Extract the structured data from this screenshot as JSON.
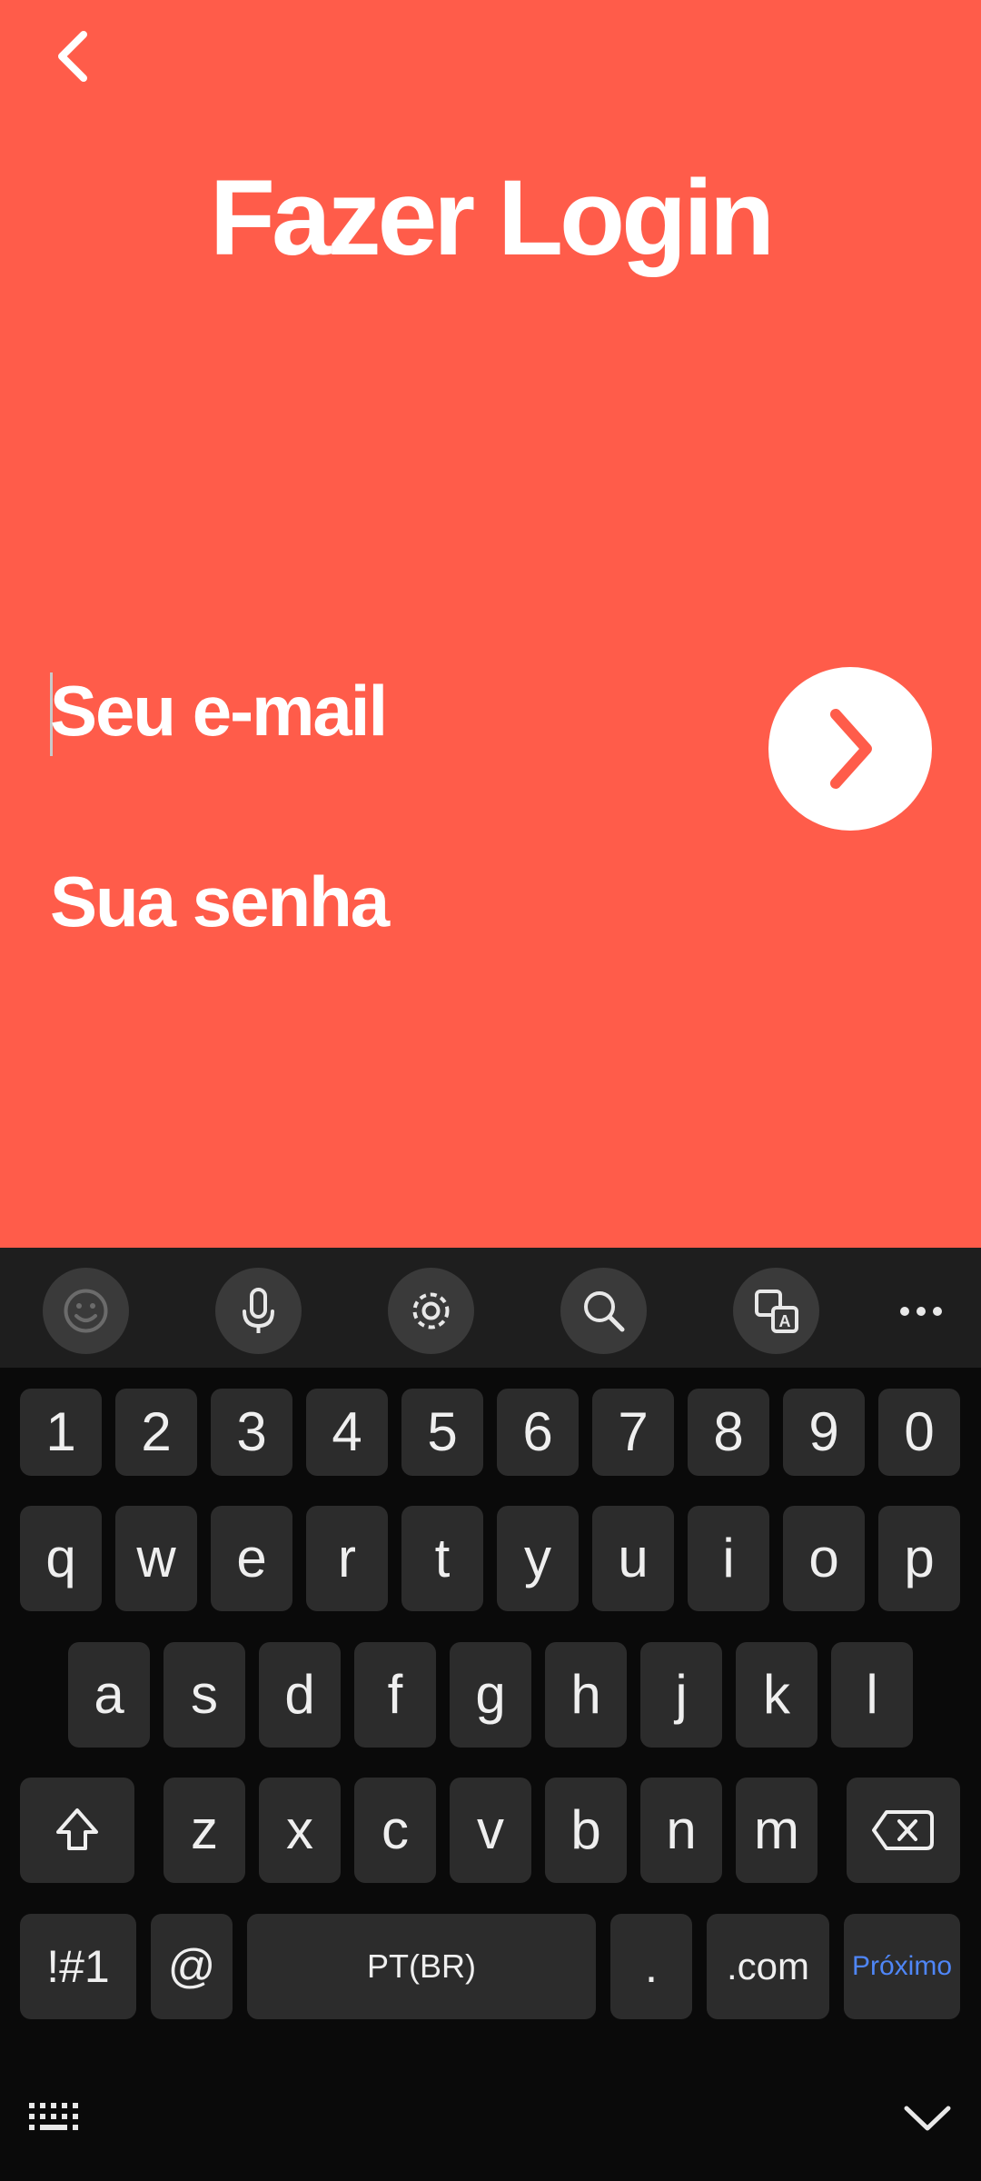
{
  "app": {
    "title": "Fazer Login",
    "email_placeholder": "Seu e-mail",
    "password_placeholder": "Sua senha",
    "colors": {
      "background": "#ff5c4a",
      "text": "#ffffff",
      "keyboard_bg": "#0a0a0a",
      "key_bg": "#2c2c2c",
      "action_blue": "#4f86f7"
    }
  },
  "keyboard": {
    "toolbar_icons": [
      "emoji-icon",
      "microphone-icon",
      "settings-icon",
      "search-icon",
      "translate-icon",
      "more-icon"
    ],
    "row_numbers": [
      "1",
      "2",
      "3",
      "4",
      "5",
      "6",
      "7",
      "8",
      "9",
      "0"
    ],
    "row_q": [
      "q",
      "w",
      "e",
      "r",
      "t",
      "y",
      "u",
      "i",
      "o",
      "p"
    ],
    "row_a": [
      "a",
      "s",
      "d",
      "f",
      "g",
      "h",
      "j",
      "k",
      "l"
    ],
    "row_z": [
      "z",
      "x",
      "c",
      "v",
      "b",
      "n",
      "m"
    ],
    "symbols_label": "!#1",
    "at_label": "@",
    "space_label": "PT(BR)",
    "period_label": ".",
    "dotcom_label": ".com",
    "action_label": "Próximo"
  }
}
